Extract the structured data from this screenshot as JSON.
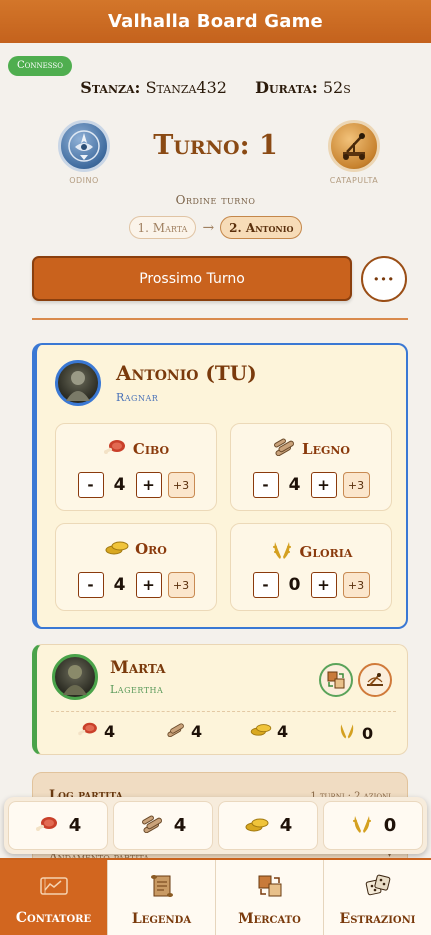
{
  "app": {
    "title": "Valhalla Board Game"
  },
  "status": {
    "connection": "Connesso"
  },
  "session": {
    "room_label": "Stanza:",
    "room_value": "Stanza432",
    "duration_label": "Durata:",
    "duration_value": "52s"
  },
  "factions": {
    "left": {
      "name": "Odino",
      "icon": "odin-emblem-icon",
      "color": "#3f6b9e"
    },
    "right": {
      "name": "Catapulta",
      "icon": "catapult-emblem-icon",
      "color": "#c7822e"
    }
  },
  "turn": {
    "title": "Turno: 1",
    "order_label": "Ordine turno",
    "order": [
      {
        "label": "1. Marta",
        "current": false
      },
      {
        "label": "2. Antonio",
        "current": true
      }
    ],
    "arrow": "→"
  },
  "actions": {
    "next_turn": "Prossimo Turno",
    "more": "···"
  },
  "current_player": {
    "name": "Antonio (TU)",
    "character": "Ragnar",
    "accent": "#3a78d4",
    "resources": [
      {
        "key": "cibo",
        "label": "Cibo",
        "icon": "meat-icon",
        "value": "4",
        "minus": "-",
        "plus": "+",
        "bonus": "+3"
      },
      {
        "key": "legno",
        "label": "Legno",
        "icon": "wood-logs-icon",
        "value": "4",
        "minus": "-",
        "plus": "+",
        "bonus": "+3"
      },
      {
        "key": "oro",
        "label": "Oro",
        "icon": "gold-coins-icon",
        "value": "4",
        "minus": "-",
        "plus": "+",
        "bonus": "+3"
      },
      {
        "key": "gloria",
        "label": "Gloria",
        "icon": "laurel-icon",
        "value": "0",
        "minus": "-",
        "plus": "+",
        "bonus": "+3"
      }
    ]
  },
  "other_player": {
    "name": "Marta",
    "character": "Lagertha",
    "accent": "#4aa34a",
    "badges": [
      "trade-icon",
      "catapult-icon"
    ],
    "resources": [
      {
        "icon": "meat-icon",
        "value": "4"
      },
      {
        "icon": "wood-logs-icon",
        "value": "4"
      },
      {
        "icon": "gold-coins-icon",
        "value": "4"
      },
      {
        "icon": "laurel-icon",
        "value": "0"
      }
    ]
  },
  "log": {
    "title": "Log partita",
    "meta": "1 turni · 2 azioni",
    "subtitle": "Andamento partita",
    "toggle": "▾"
  },
  "sticky": [
    {
      "icon": "meat-icon",
      "value": "4"
    },
    {
      "icon": "wood-logs-icon",
      "value": "4"
    },
    {
      "icon": "gold-coins-icon",
      "value": "4"
    },
    {
      "icon": "laurel-icon",
      "value": "0"
    }
  ],
  "nav": [
    {
      "label": "Contatore",
      "icon": "counter-icon",
      "active": true
    },
    {
      "label": "Legenda",
      "icon": "scroll-icon",
      "active": false
    },
    {
      "label": "Mercato",
      "icon": "trade-icon",
      "active": false
    },
    {
      "label": "Estrazioni",
      "icon": "dice-icon",
      "active": false
    }
  ]
}
